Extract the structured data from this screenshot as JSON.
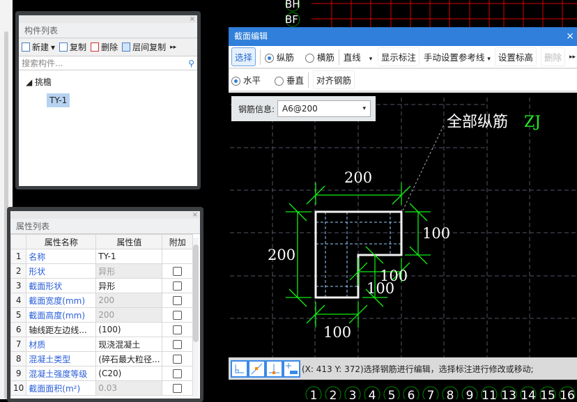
{
  "background": {
    "axis_labels": [
      "BH",
      "BF"
    ],
    "bottom_axis": [
      "1",
      "2",
      "3",
      "4",
      "5",
      "6",
      "7",
      "8",
      "9",
      "11",
      "13",
      "14",
      "15",
      "16"
    ]
  },
  "component_list": {
    "title": "构件列表",
    "close": "×",
    "toolbar": {
      "new": "新建",
      "copy": "复制",
      "delete": "删除",
      "floor_copy": "层间复制",
      "more": "▸▸"
    },
    "search_placeholder": "搜索构件...",
    "tree": {
      "group": "挑檐",
      "item": "TY-1"
    }
  },
  "properties": {
    "title": "属性列表",
    "close": "×",
    "headers": {
      "num": "",
      "name": "属性名称",
      "value": "属性值",
      "extra": "附加"
    },
    "rows": [
      {
        "n": "1",
        "name": "名称",
        "value": "TY-1",
        "blue": true,
        "ro": false,
        "cb": false
      },
      {
        "n": "2",
        "name": "形状",
        "value": "异形",
        "blue": true,
        "ro": true,
        "cb": true
      },
      {
        "n": "3",
        "name": "截面形状",
        "value": "异形",
        "blue": true,
        "ro": false,
        "cb": true
      },
      {
        "n": "4",
        "name": "截面宽度(mm)",
        "value": "200",
        "blue": true,
        "ro": true,
        "cb": true
      },
      {
        "n": "5",
        "name": "截面高度(mm)",
        "value": "200",
        "blue": true,
        "ro": true,
        "cb": true
      },
      {
        "n": "6",
        "name": "轴线距左边线...",
        "value": "(100)",
        "blue": false,
        "ro": false,
        "cb": true
      },
      {
        "n": "7",
        "name": "材质",
        "value": "现浇混凝土",
        "blue": true,
        "ro": false,
        "cb": true
      },
      {
        "n": "8",
        "name": "混凝土类型",
        "value": "(碎石最大粒径...",
        "blue": true,
        "ro": false,
        "cb": true
      },
      {
        "n": "9",
        "name": "混凝土强度等级",
        "value": "(C20)",
        "blue": true,
        "ro": false,
        "cb": true
      },
      {
        "n": "10",
        "name": "截面面积(m²)",
        "value": "0.03",
        "blue": true,
        "ro": true,
        "cb": true
      }
    ]
  },
  "dialog": {
    "title": "截面编辑",
    "close": "×",
    "toolbar1": {
      "select": "选择",
      "longitudinal": "纵筋",
      "transverse": "横筋",
      "line_mode": "直线",
      "show_dims": "显示标注",
      "manual_ref": "手动设置参考线",
      "set_elev": "设置标高",
      "delete": "删除",
      "more": "▸▸"
    },
    "toolbar2": {
      "horizontal": "水平",
      "vertical": "垂直",
      "align": "对齐钢筋"
    },
    "rebar_label": "钢筋信息:",
    "rebar_value": "A6@200",
    "annotation": {
      "text": "全部纵筋",
      "code": "ZJ"
    },
    "dims": {
      "top": "200",
      "left": "200",
      "right": "100",
      "bottom": "100",
      "inner_h": "100",
      "inner_v": "100"
    },
    "status": "(X: 413 Y: 372)选择钢筋进行编辑，选择标注进行修改或移动;"
  }
}
